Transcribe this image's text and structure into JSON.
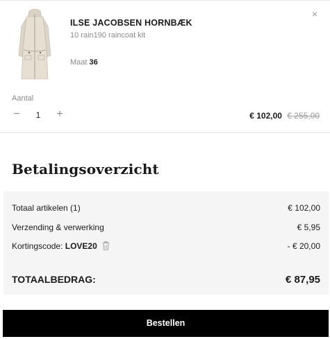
{
  "cart_item": {
    "brand": "ILSE JACOBSEN HORNBÆK",
    "product_name": "10 rain190 raincoat kit",
    "size_label": "Maat",
    "size_value": "36",
    "quantity_label": "Aantal",
    "quantity": "1",
    "minus_symbol": "−",
    "plus_symbol": "+",
    "remove_symbol": "×",
    "price_current": "€ 102,00",
    "price_old": "€ 255,00",
    "image_icon": "raincoat-product-image"
  },
  "summary": {
    "title": "Betalingsoverzicht",
    "rows": [
      {
        "label": "Totaal artikelen (1)",
        "value": "€ 102,00"
      },
      {
        "label": "Verzending & verwerking",
        "value": "€ 5,95"
      },
      {
        "label": "Kortingscode:",
        "code": "LOVE20",
        "value": "- € 20,00"
      }
    ],
    "total_label": "TOTAALBEDRAG:",
    "total_value": "€ 87,95"
  },
  "actions": {
    "order_button": "Bestellen"
  },
  "colors": {
    "button_bg": "#000000",
    "summary_bg": "#f5f5f5",
    "muted_text": "#8a8a8a"
  }
}
